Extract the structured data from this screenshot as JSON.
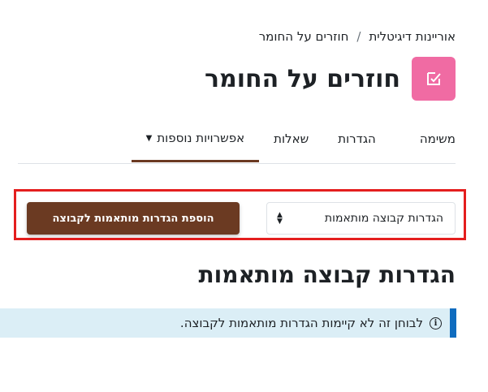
{
  "breadcrumb": {
    "items": [
      "אוריינות דיגיטלית",
      "חוזרים על החומר"
    ],
    "separator": "/"
  },
  "header": {
    "title": "חוזרים על החומר",
    "icon": "edit-checkbox-icon",
    "icon_bg": "#f06ba3"
  },
  "tabs": {
    "items": [
      {
        "label": "משימה"
      },
      {
        "label": "הגדרות"
      },
      {
        "label": "שאלות"
      },
      {
        "label": "אפשרויות נוספות"
      }
    ],
    "active_index": 3
  },
  "select": {
    "value": "הגדרות קבוצה מותאמות"
  },
  "add_button": {
    "label": "הוספת הגדרות מותאמות לקבוצה"
  },
  "section": {
    "title": "הגדרות קבוצה מותאמות"
  },
  "alert": {
    "text": "לבוחן זה לא קיימות הגדרות מותאמות לקבוצה.",
    "icon": "info-icon"
  },
  "colors": {
    "accent": "#6b3a22",
    "highlight": "#e41e1e",
    "alert_bg": "#dbeef6",
    "alert_border": "#0f6cbf"
  }
}
